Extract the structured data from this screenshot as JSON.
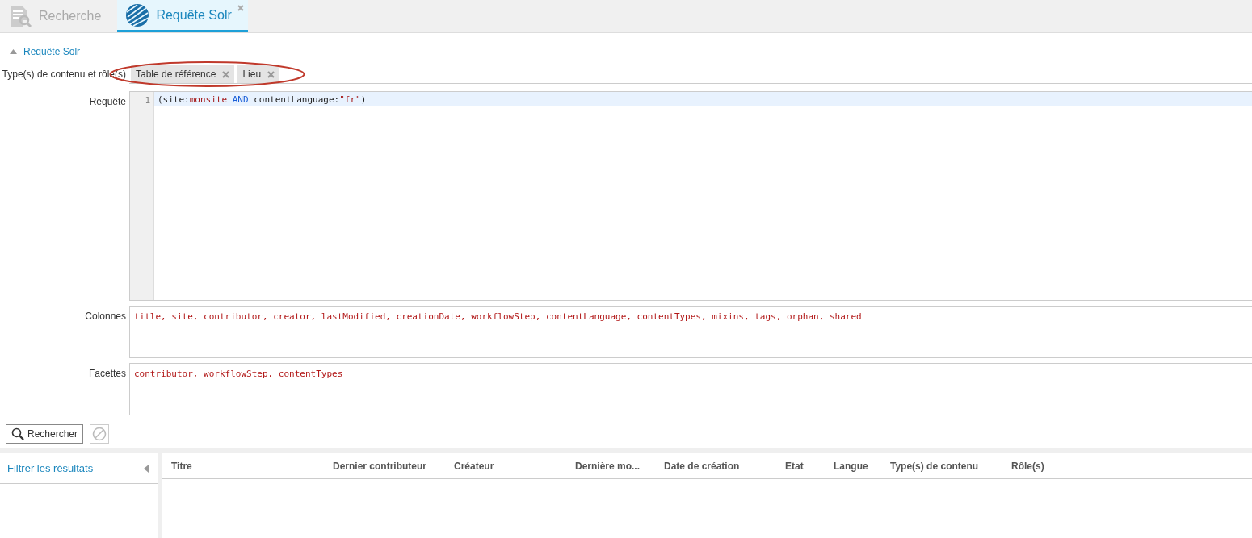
{
  "tabs": [
    {
      "label": "Recherche",
      "selected": false,
      "closable": false
    },
    {
      "label": "Requête Solr",
      "selected": true,
      "closable": true
    }
  ],
  "section": {
    "title": "Requête Solr",
    "expanded": true
  },
  "content_types": {
    "label": "Type(s) de contenu et rôle(s)",
    "tags": [
      "Table de référence",
      "Lieu"
    ],
    "highlighted": true
  },
  "query": {
    "label": "Requête",
    "lines": [
      {
        "number": "1",
        "tokens": [
          {
            "kind": "plain",
            "text": "(site:"
          },
          {
            "kind": "value",
            "text": "monsite"
          },
          {
            "kind": "keyword",
            "text": " AND "
          },
          {
            "kind": "plain",
            "text": "contentLanguage:"
          },
          {
            "kind": "value",
            "text": "\"fr\""
          },
          {
            "kind": "plain",
            "text": ")"
          }
        ]
      }
    ]
  },
  "columns_field": {
    "label": "Colonnes",
    "value": "title, site, contributor, creator, lastModified, creationDate, workflowStep, contentLanguage, contentTypes, mixins, tags, orphan, shared"
  },
  "facets_field": {
    "label": "Facettes",
    "value": "contributor, workflowStep, contentTypes"
  },
  "buttons": {
    "search": "Rechercher",
    "reset_disabled": true
  },
  "filter_panel": {
    "title": "Filtrer les résultats"
  },
  "results": {
    "columns": [
      "Titre",
      "Dernier contributeur",
      "Créateur",
      "Dernière mo...",
      "Date de création",
      "Etat",
      "Langue",
      "Type(s) de contenu",
      "Rôle(s)"
    ]
  }
}
